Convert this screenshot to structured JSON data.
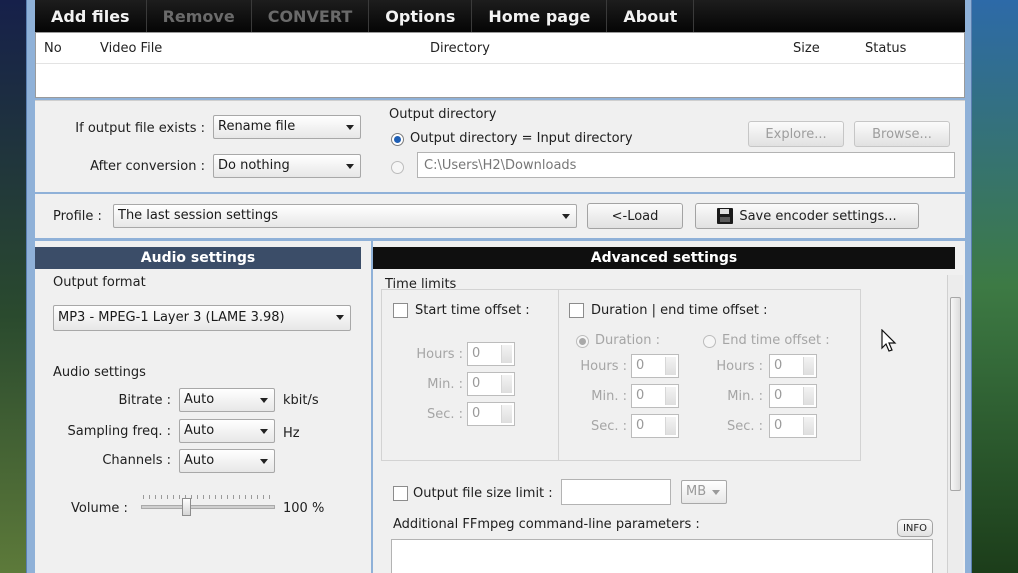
{
  "menu": {
    "items": [
      {
        "label": "Add files",
        "disabled": false
      },
      {
        "label": "Remove",
        "disabled": true
      },
      {
        "label": "CONVERT",
        "disabled": true
      },
      {
        "label": "Options",
        "disabled": false
      },
      {
        "label": "Home page",
        "disabled": false
      },
      {
        "label": "About",
        "disabled": false
      }
    ]
  },
  "filelist": {
    "columns": {
      "no": "No",
      "video_file": "Video File",
      "directory": "Directory",
      "size": "Size",
      "status": "Status"
    }
  },
  "output": {
    "if_exists_label": "If output file exists :",
    "if_exists_value": "Rename file",
    "after_conversion_label": "After conversion :",
    "after_conversion_value": "Do nothing",
    "output_directory_label": "Output directory",
    "option_same": "Output directory = Input directory",
    "custom_path": "C:\\Users\\H2\\Downloads",
    "explore_label": "Explore...",
    "browse_label": "Browse..."
  },
  "profile": {
    "label": "Profile :",
    "value": "The last session settings",
    "load_label": "<-Load",
    "save_label": "Save encoder settings..."
  },
  "audio": {
    "title": "Audio settings",
    "output_format_label": "Output format",
    "output_format_value": "MP3 - MPEG-1 Layer 3 (LAME 3.98)",
    "section_label": "Audio settings",
    "bitrate_label": "Bitrate :",
    "bitrate_value": "Auto",
    "bitrate_unit": "kbit/s",
    "sampling_label": "Sampling freq. :",
    "sampling_value": "Auto",
    "sampling_unit": "Hz",
    "channels_label": "Channels :",
    "channels_value": "Auto",
    "volume_label": "Volume :",
    "volume_value": "100 %",
    "volume_level": 0.33
  },
  "advanced": {
    "title": "Advanced settings",
    "time_limits_label": "Time limits",
    "start_offset_label": "Start time offset :",
    "duration_end_label": "Duration | end time offset :",
    "duration_label": "Duration :",
    "end_offset_label": "End time offset :",
    "hours_label": "Hours :",
    "min_label": "Min. :",
    "sec_label": "Sec. :",
    "zero": "0",
    "size_limit_label": "Output file size limit :",
    "size_unit": "MB",
    "ffmpeg_label": "Additional FFmpeg command-line parameters :",
    "info_label": "INFO"
  }
}
